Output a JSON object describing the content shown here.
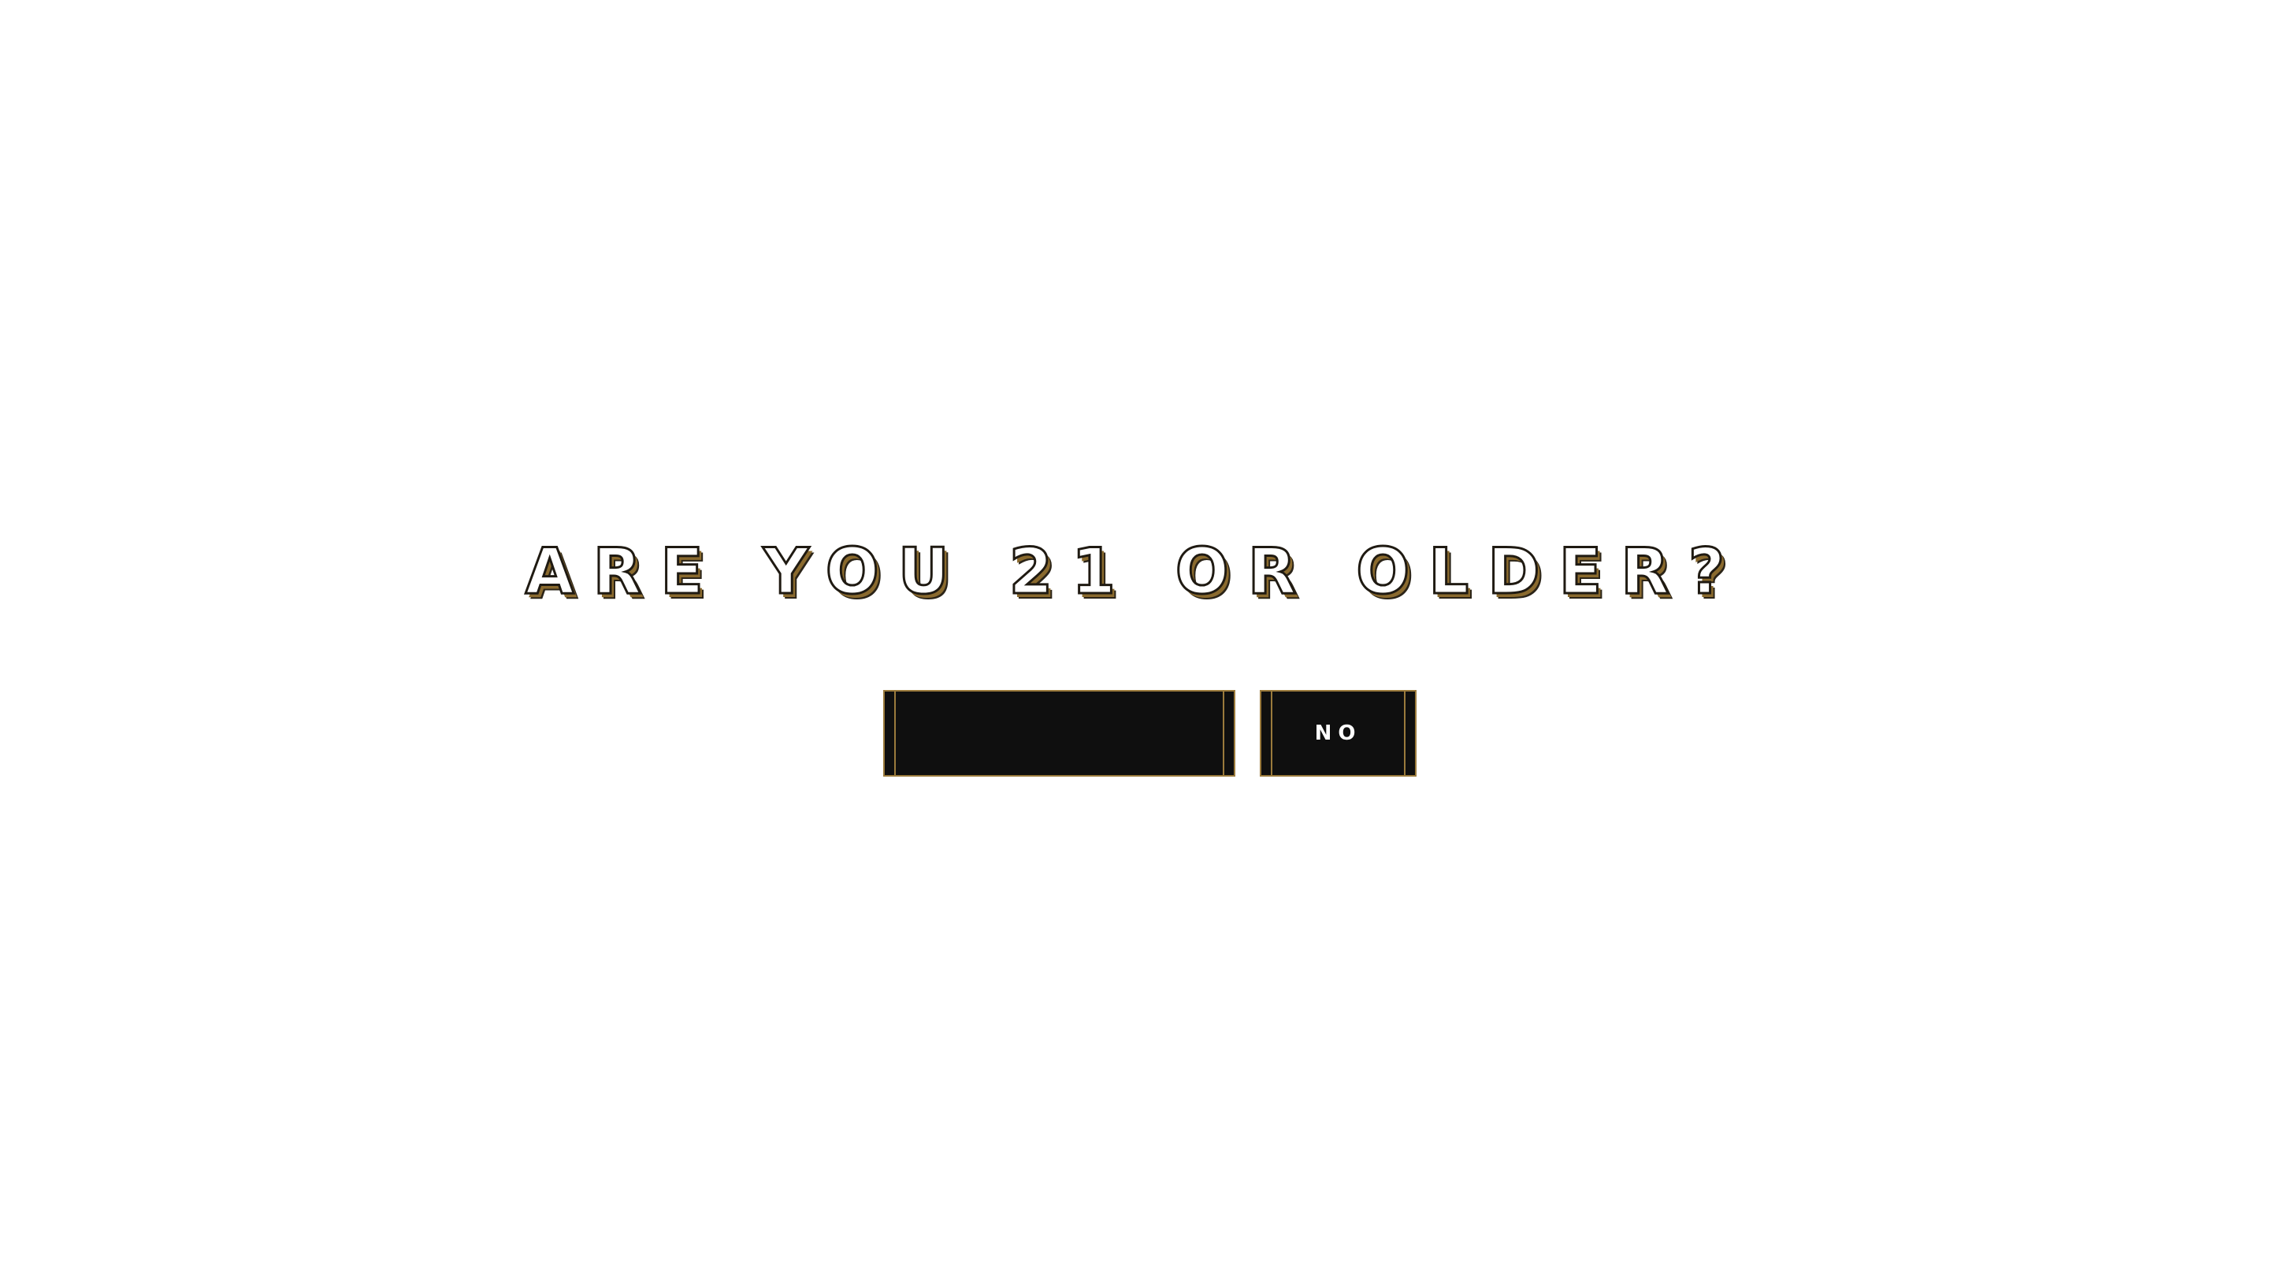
{
  "age_gate": {
    "question": "ARE YOU 21 OR OLDER?",
    "yes_label": "",
    "no_label": "NO"
  },
  "colors": {
    "background": "#ffffff",
    "button_fill": "#0f0f0f",
    "button_border": "#9a7a3c",
    "heading_shadow": "#8a6a2e"
  }
}
